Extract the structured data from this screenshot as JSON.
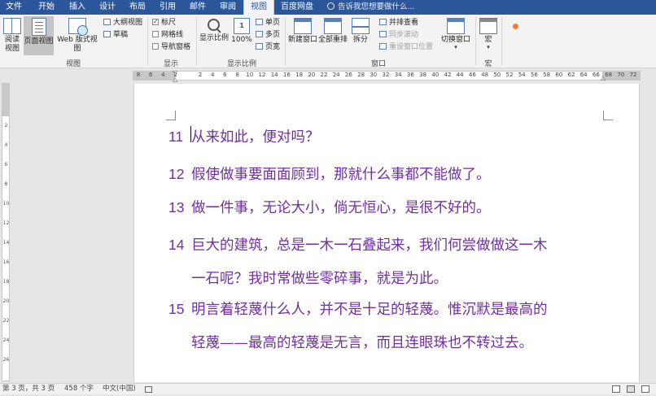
{
  "tabs": [
    "文件",
    "开始",
    "插入",
    "设计",
    "布局",
    "引用",
    "邮件",
    "审阅",
    "视图",
    "百度网盘"
  ],
  "active_tab": "视图",
  "tell_me": "告诉我您想要做什么...",
  "ribbon": {
    "views": {
      "read": "阅读视图",
      "print": "页面视图",
      "web": "Web 版式视图",
      "outline": "大纲视图",
      "draft": "草稿",
      "label": "视图"
    },
    "show": {
      "ruler": "标尺",
      "gridlines": "网格线",
      "nav_pane": "导航窗格",
      "label": "显示"
    },
    "zoom": {
      "zoom": "显示比例",
      "hundred": "100%",
      "one_page": "单页",
      "multi_page": "多页",
      "page_width": "页宽",
      "label": "显示比例"
    },
    "window": {
      "new_window": "新建窗口",
      "arrange_all": "全部重排",
      "split": "拆分",
      "side_by_side": "并排查看",
      "sync_scroll": "同步滚动",
      "reset_pos": "重设窗口位置",
      "switch_windows": "切换窗口",
      "label": "窗口"
    },
    "macros": {
      "macros": "宏",
      "label": "宏"
    }
  },
  "ruler_ticks": [
    "8",
    "6",
    "4",
    "2",
    "",
    "2",
    "4",
    "6",
    "8",
    "10",
    "12",
    "14",
    "16",
    "18",
    "20",
    "22",
    "24",
    "26",
    "28",
    "30",
    "32",
    "34",
    "36",
    "38",
    "40",
    "42",
    "44",
    "46",
    "48",
    "50",
    "52",
    "54",
    "56",
    "58",
    "60",
    "62",
    "64",
    "66",
    "68",
    "70",
    "72"
  ],
  "vruler_ticks": [
    "2",
    "4",
    "6",
    "8",
    "10",
    "12",
    "14",
    "16",
    "18",
    "20",
    "22",
    "24",
    "26"
  ],
  "document": {
    "paragraphs": [
      {
        "num": "11",
        "lines": [
          "从来如此，便对吗？"
        ]
      },
      {
        "num": "12",
        "lines": [
          "假使做事要面面顾到，那就什么事都不能做了。"
        ]
      },
      {
        "num": "13",
        "lines": [
          "做一件事，无论大小，倘无恒心，是很不好的。"
        ]
      },
      {
        "num": "14",
        "lines": [
          "巨大的建筑，总是一木一石叠起来，我们何尝做做这一木",
          "一石呢？我时常做些零碎事，就是为此。"
        ]
      },
      {
        "num": "15",
        "lines": [
          "明言着轻蔑什么人，并不是十足的轻蔑。惟沉默是最高的",
          "轻蔑——最高的轻蔑是无言，而且连眼珠也不转过去。"
        ]
      }
    ]
  },
  "status": {
    "page": "第 3 页，共 3 页",
    "words": "458 个字",
    "language": "中文(中国)"
  },
  "colors": {
    "accent": "#2b579a",
    "text": "#7030a0"
  }
}
